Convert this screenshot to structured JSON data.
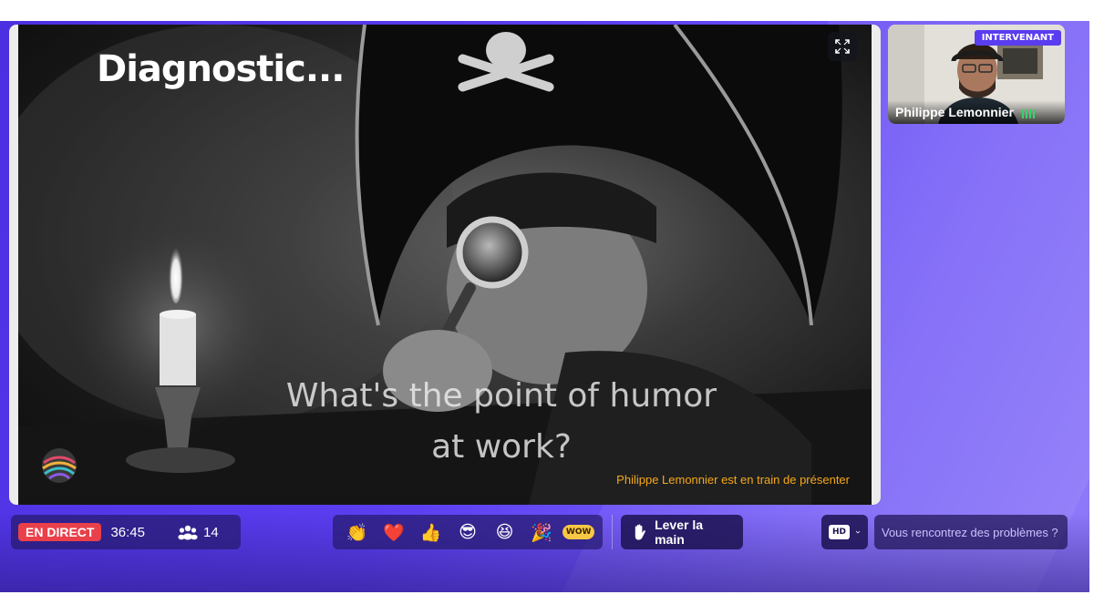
{
  "presentation": {
    "slide_title": "Diagnostic...",
    "quote_line1": "What's the point of humor",
    "quote_line2": "at work?",
    "presenter_status": "Philippe Lemonnier est en train de présenter",
    "expand_icon": "expand-icon"
  },
  "speaker": {
    "role_badge": "INTERVENANT",
    "name": "Philippe Lemonnier",
    "audio_icon": "audio-level-icon"
  },
  "status": {
    "live_label": "EN DIRECT",
    "elapsed": "36:45",
    "viewer_count": "14",
    "viewer_icon": "participants-icon"
  },
  "reactions": {
    "items": [
      {
        "icon": "clap-icon",
        "glyph": "👏"
      },
      {
        "icon": "heart-icon",
        "glyph": "❤️"
      },
      {
        "icon": "thumbs-up-icon",
        "glyph": "👍"
      },
      {
        "icon": "cool-face-icon",
        "glyph": "😎"
      },
      {
        "icon": "laugh-face-icon",
        "glyph": "😆"
      },
      {
        "icon": "party-popper-icon",
        "glyph": "🎉"
      },
      {
        "icon": "wow-icon",
        "glyph": "WOW"
      }
    ]
  },
  "raise_hand": {
    "label": "Lever la main",
    "icon": "hand-icon"
  },
  "quality": {
    "selected": "HD",
    "icon": "chevron-down-icon"
  },
  "help": {
    "label": "Vous rencontrez des problèmes ?"
  },
  "colors": {
    "brand": "#5b3df0",
    "live": "#e9404a",
    "presenter_note": "#f6a81a"
  }
}
